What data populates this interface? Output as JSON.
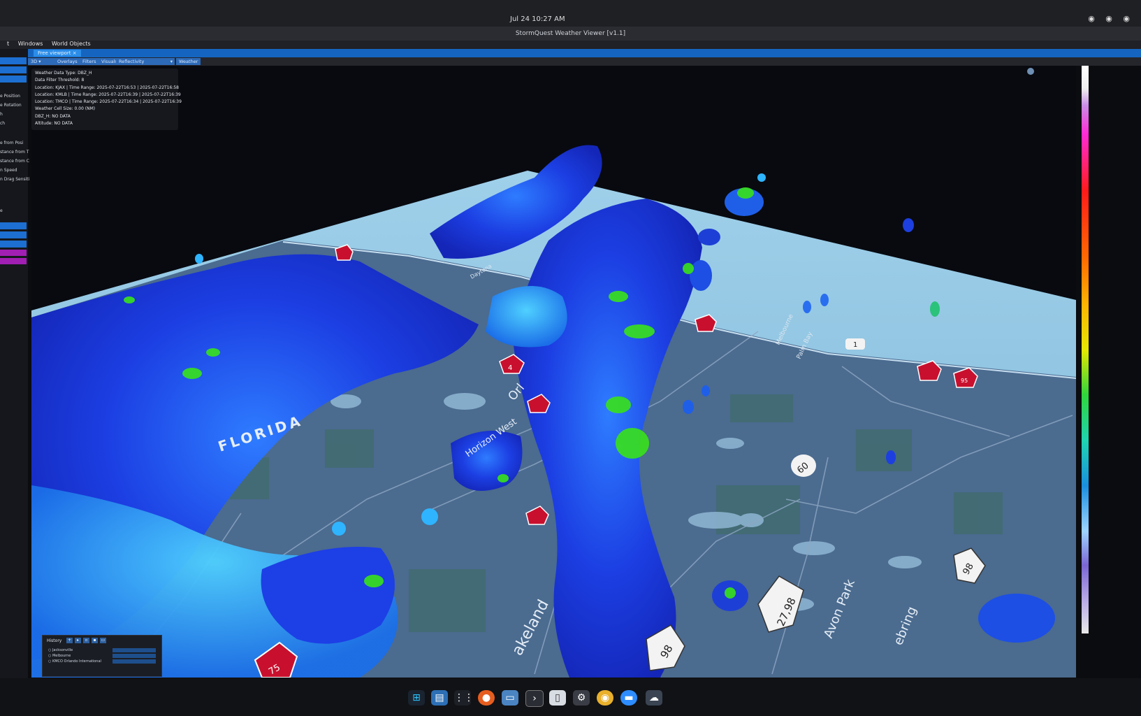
{
  "window": {
    "clock": "Jul 24  10:27 AM",
    "title": "StormQuest Weather Viewer [v1.1]",
    "tray_icons": [
      "network-icon",
      "volume-icon",
      "battery-icon"
    ]
  },
  "menu": {
    "items": [
      "t",
      "Windows",
      "World Objects"
    ]
  },
  "tabs": [
    {
      "label": "Free viewport"
    }
  ],
  "toolbar": {
    "view_mode": "3D",
    "overlays": "Overlays",
    "filters": "Filters",
    "visuals": "Visuals",
    "product": "Reflectivity",
    "weather": "Weather"
  },
  "sidebar": {
    "labels": [
      "e Position",
      "e Rotation",
      "h",
      "ch",
      "e from Posi",
      "stance from T",
      "stance from C",
      "n Speed",
      "n Drag Sensiti",
      "e"
    ]
  },
  "info_panel": {
    "lines": [
      "Weather Data Type: DBZ_H",
      "Data Filter Threshold: 8",
      "Location: KJAX | Time Range: 2025-07-22T16:53 | 2025-07-22T16:58",
      "Location: KMLB | Time Range: 2025-07-22T16:39 | 2025-07-22T16:39",
      "Location: TMCO | Time Range: 2025-07-22T16:34 | 2025-07-22T16:39",
      "Weather Cell Size: 0.00 (NM)",
      "DBZ_H: NO DATA",
      "Altitude: NO DATA"
    ]
  },
  "history": {
    "title": "History",
    "rows": [
      "Jacksonville",
      "Melbourne",
      "KMCO Orlando International"
    ]
  },
  "map_labels": {
    "florida": "FLORIDA",
    "orlando": "Orl",
    "horizon_west": "Horizon West",
    "lakeland": "akeland",
    "avon_park": "Avon Park",
    "sebring": "ebring",
    "palm_bay": "Palm Bay",
    "melbourne": "Melbourne",
    "daytona": "Daytona"
  },
  "highway_shields": {
    "route_60": "60",
    "route_27_98": "27,98",
    "route_98": "98",
    "route_98_b": "98",
    "route_1": "1",
    "i75": "75",
    "i4": "4",
    "i95": "95"
  },
  "taskbar": {
    "apps": [
      "overview-icon",
      "files-icon",
      "app-grid-icon",
      "firefox-icon",
      "folder-icon",
      "terminal-icon",
      "docs-icon",
      "settings-icon",
      "chrome-icon",
      "zoom-icon",
      "stormquest-icon"
    ]
  },
  "colors": {
    "accent": "#1565c0",
    "land": "#4b6b8f",
    "sea": "#8ec3e3",
    "storm_blue": "#1f3fe0",
    "storm_cyan": "#23a6ff",
    "storm_green": "#39e21a"
  }
}
